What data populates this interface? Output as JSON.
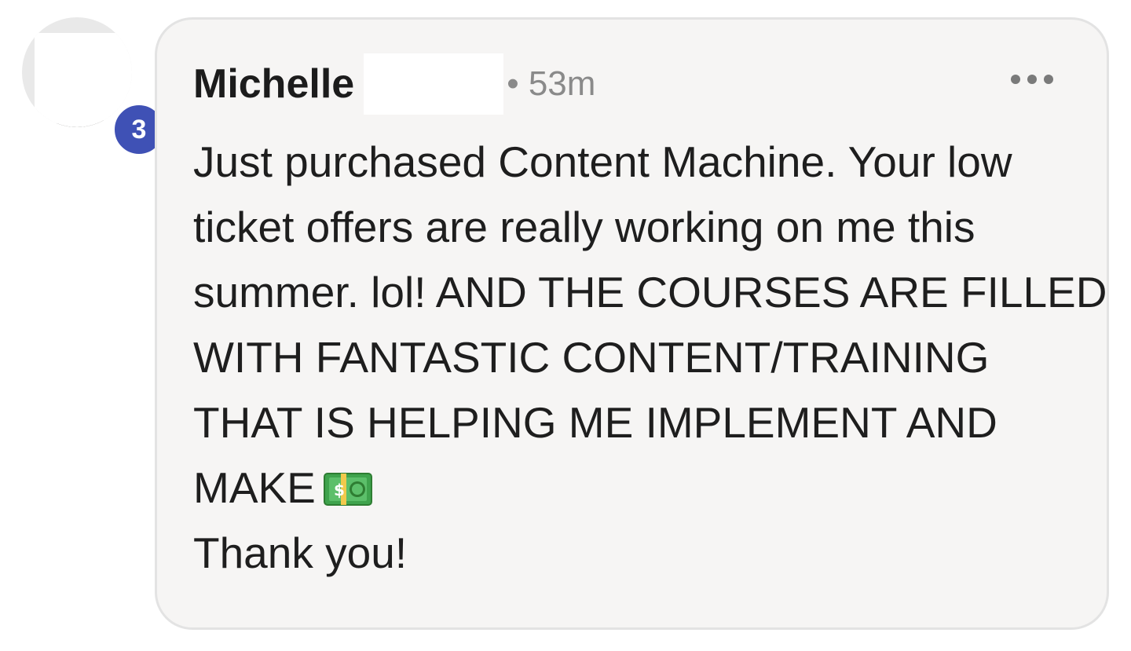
{
  "post": {
    "author_name": "Michelle",
    "separator": "•",
    "timestamp": "53m",
    "level_badge": "3",
    "more_icon": "ellipsis-horizontal-icon",
    "body_lines": [
      "Just purchased Content Machine. Your low",
      "ticket offers are really working on me this",
      "summer. lol! AND THE COURSES ARE FILLED",
      "WITH FANTASTIC CONTENT/TRAINING",
      "THAT IS HELPING ME IMPLEMENT AND",
      "MAKE",
      "Thank you!"
    ],
    "emoji": "money-bill-emoji"
  },
  "colors": {
    "bubble_bg": "#f6f5f4",
    "bubble_border": "#e3e3e3",
    "badge": "#3f51b5",
    "text": "#1e1e1e",
    "meta": "#8a8a8a"
  }
}
